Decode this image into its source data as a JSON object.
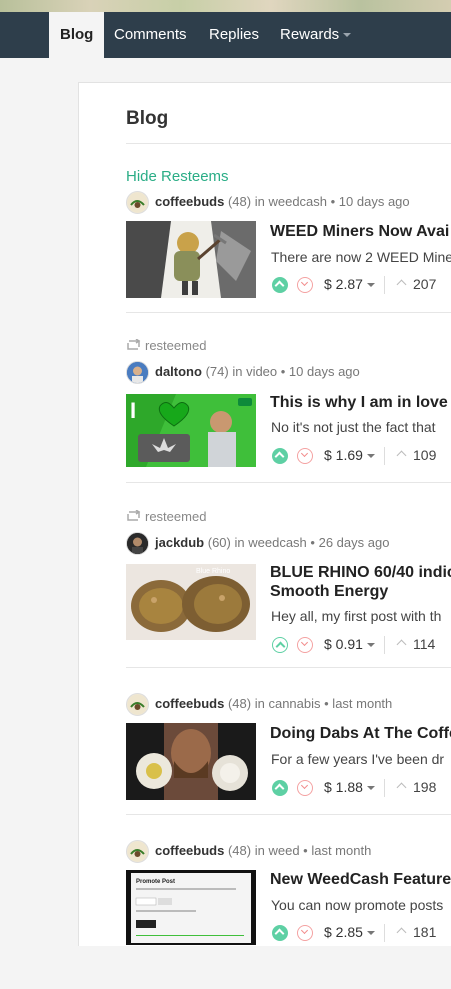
{
  "tabs": [
    {
      "label": "Blog"
    },
    {
      "label": "Comments"
    },
    {
      "label": "Replies"
    },
    {
      "label": "Rewards"
    }
  ],
  "page_title": "Blog",
  "hide_resteems": "Hide Resteems",
  "resteemed_label": "resteemed",
  "in_label": "in",
  "posts": [
    {
      "author": "coffeebuds",
      "rep": "(48)",
      "category": "weedcash",
      "time": "• 10 days ago",
      "title": "WEED Miners Now Avai",
      "summary": "There are now 2 WEED Mine",
      "payout": "$ 2.87",
      "votes": "207",
      "voted": true,
      "resteemed": false
    },
    {
      "author": "daltono",
      "rep": "(74)",
      "category": "video",
      "time": "• 10 days ago",
      "title": "This is why I am in love",
      "summary": "No it's not just the fact that",
      "payout": "$ 1.69",
      "votes": "109",
      "voted": true,
      "resteemed": true
    },
    {
      "author": "jackdub",
      "rep": "(60)",
      "category": "weedcash",
      "time": "• 26 days ago",
      "title": "BLUE RHINO 60/40 indic Smooth Energy",
      "summary": "Hey all, my first post with th",
      "payout": "$ 0.91",
      "votes": "114",
      "voted": false,
      "resteemed": true,
      "thumb_text": "Blue Rhino"
    },
    {
      "author": "coffeebuds",
      "rep": "(48)",
      "category": "cannabis",
      "time": "• last month",
      "title": "Doing Dabs At The Coffe",
      "summary": "For a few years I've been dr",
      "payout": "$ 1.88",
      "votes": "198",
      "voted": true,
      "resteemed": false
    },
    {
      "author": "coffeebuds",
      "rep": "(48)",
      "category": "weed",
      "time": "• last month",
      "title": "New WeedCash Feature",
      "summary": "You can now promote posts",
      "payout": "$ 2.85",
      "votes": "181",
      "voted": true,
      "resteemed": false,
      "thumb_text": "Promote Post"
    }
  ],
  "colors": {
    "nav_bg": "#2e3e4b",
    "accent": "#2aad86",
    "upvote": "#5ed0a4",
    "downvote": "#f28b8b"
  }
}
